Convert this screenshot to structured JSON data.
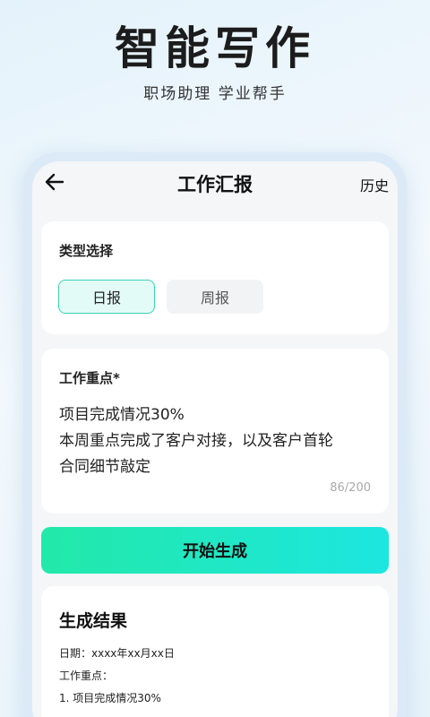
{
  "hero": {
    "title": "智能写作",
    "subtitle": "职场助理 学业帮手"
  },
  "nav": {
    "back_icon": "arrow-left-icon",
    "title": "工作汇报",
    "history_label": "历史"
  },
  "type_select": {
    "label": "类型选择",
    "options": [
      "日报",
      "周报"
    ],
    "selected": "日报"
  },
  "work_focus": {
    "label": "工作重点*",
    "lines": [
      "项目完成情况30%",
      "本周重点完成了客户对接，以及客户首轮",
      "合同细节敲定"
    ],
    "counter": "86/200"
  },
  "generate_button": {
    "label": "开始生成"
  },
  "result": {
    "title": "生成结果",
    "lines": [
      "日期：xxxx年xx月xx日",
      "工作重点：",
      "1. 项目完成情况30%"
    ]
  },
  "colors": {
    "accent_start": "#22e9a8",
    "accent_end": "#1de6e0",
    "selected_border": "#3ccfb7",
    "selected_bg": "#e3fbf6"
  }
}
